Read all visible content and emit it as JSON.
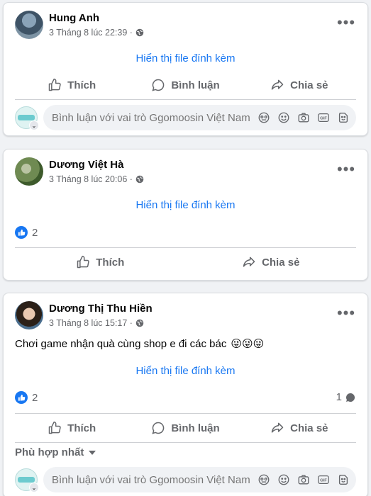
{
  "posts": [
    {
      "author": "Hung Anh",
      "meta": "3 Tháng 8 lúc 22:39 ·",
      "attachment_link": "Hiển thị file đính kèm",
      "actions": {
        "like": "Thích",
        "comment": "Bình luận",
        "share": "Chia sẻ"
      },
      "comment_placeholder": "Bình luận với vai trò Ggomoosin Việt Nam"
    },
    {
      "author": "Dương Việt Hà",
      "meta": "3 Tháng 8 lúc 20:06 ·",
      "attachment_link": "Hiển thị file đính kèm",
      "reaction_count": "2",
      "actions": {
        "like": "Thích",
        "share": "Chia sẻ"
      }
    },
    {
      "author": "Dương Thị Thu Hiền",
      "meta": "3 Tháng 8 lúc 15:17 ·",
      "text": "Chơi game nhận quà cùng shop e đi các bác",
      "emojis": "😜😜😜",
      "attachment_link": "Hiển thị file đính kèm",
      "reaction_count": "2",
      "comment_count": "1",
      "actions": {
        "like": "Thích",
        "comment": "Bình luận",
        "share": "Chia sẻ"
      },
      "sort_label": "Phù hợp nhất",
      "comment_placeholder": "Bình luận với vai trò Ggomoosin Việt Nam"
    }
  ],
  "colors": {
    "accent": "#1877f2",
    "muted": "#65676b",
    "background": "#f0f2f5"
  }
}
